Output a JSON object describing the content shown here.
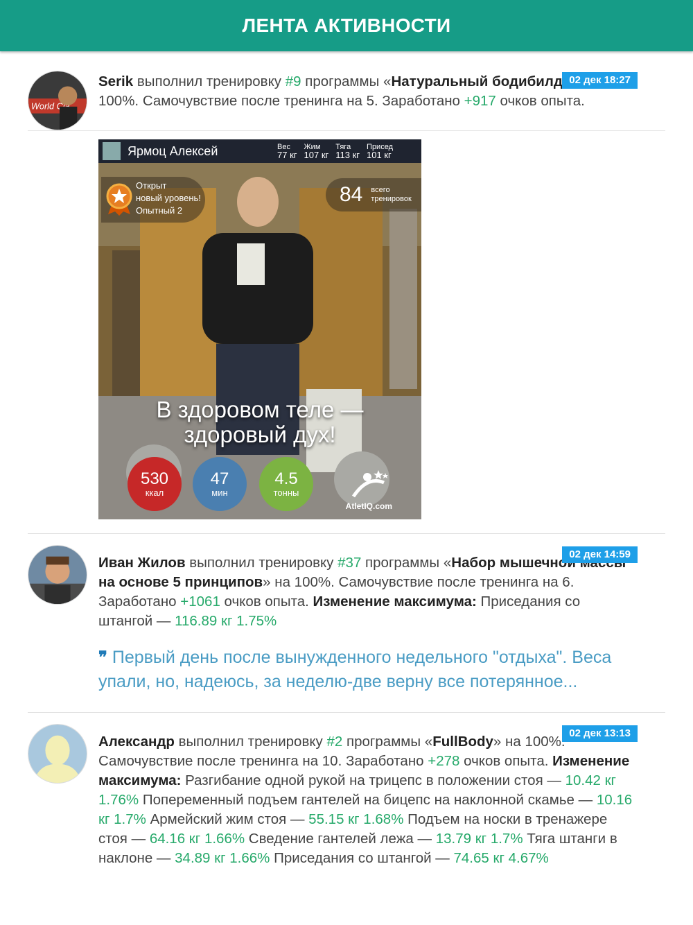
{
  "header": {
    "title": "ЛЕНТА АКТИВНОСТИ"
  },
  "posts": [
    {
      "user": "Serik",
      "date": "02 дек 18:27",
      "t1": " выполнил тренировку ",
      "workout": "#9",
      "t2": " программы «",
      "program": "Натуральный бодибилдинг",
      "t3": "» на 100%. Самочувствие после тренинга на 5. Заработано ",
      "xp": "+917",
      "t4": " очков опыта."
    },
    {
      "user": "Иван Жилов",
      "date": "02 дек 14:59",
      "t1": " выполнил тренировку ",
      "workout": "#37",
      "t2": " программы «",
      "program": "Набор мышечной массы на основе 5 принципов",
      "t3": "» на 100%. Самочувствие после тренинга на 6. Заработано ",
      "xp": "+1061",
      "t4": " очков опыта. ",
      "max_label": "Изменение максимума:",
      "max_items": [
        {
          "name": " Приседания со штангой — ",
          "value": "116.89 кг 1.75%"
        }
      ],
      "quote_mark": "❞",
      "quote": "Первый день после вынужденного недельного \"отдыха\". Веса упали, но, надеюсь, за неделю-две верну все потерянное..."
    },
    {
      "user": "Александр",
      "date": "02 дек 13:13",
      "t1": " выполнил тренировку ",
      "workout": "#2",
      "t2": " программы «",
      "program": "FullBody",
      "t3": "» на 100%. Самочувствие после тренинга на 10. Заработано ",
      "xp": "+278",
      "t4": " очков опыта. ",
      "max_label": "Изменение максимума:",
      "max_items": [
        {
          "name": " Разгибание одной рукой на трицепс в положении стоя — ",
          "value": "10.42 кг 1.76%"
        },
        {
          "name": " Попеременный подъем гантелей на бицепс на наклонной скамье — ",
          "value": "10.16 кг 1.7%"
        },
        {
          "name": " Армейский жим стоя — ",
          "value": "55.15 кг 1.68%"
        },
        {
          "name": " Подъем на носки в тренажере стоя — ",
          "value": "64.16 кг 1.66%"
        },
        {
          "name": " Сведение гантелей лежа — ",
          "value": "13.79 кг 1.7%"
        },
        {
          "name": " Тяга штанги в наклоне — ",
          "value": "34.89 кг 1.66%"
        },
        {
          "name": " Приседания со штангой — ",
          "value": "74.65 кг 4.67%"
        }
      ]
    }
  ],
  "card": {
    "name": "Ярмоц Алексей",
    "stats": [
      {
        "label": "Вес",
        "value": "77 кг"
      },
      {
        "label": "Жим",
        "value": "107 кг"
      },
      {
        "label": "Тяга",
        "value": "113 кг"
      },
      {
        "label": "Присед",
        "value": "101 кг"
      }
    ],
    "level_line1": "Открыт",
    "level_line2": "новый уровень!",
    "level_name": "Опытный 2",
    "total_num": "84",
    "total_l1": "всего",
    "total_l2": "тренировок",
    "motto_1": "В здоровом теле —",
    "motto_2": "здоровый дух!",
    "kcal": "530",
    "kcal_u": "ккал",
    "min": "47",
    "min_u": "мин",
    "tons": "4.5",
    "tons_u": "тонны",
    "brand": "AtletIQ.com"
  },
  "colors": {
    "header": "#169c87",
    "accent_green": "#26a96a",
    "date_badge": "#1e9fe8",
    "quote": "#4a9cc4"
  }
}
